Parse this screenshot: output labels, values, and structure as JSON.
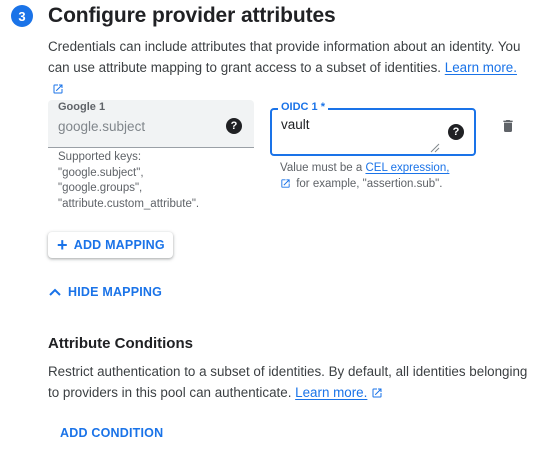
{
  "step": {
    "number": "3",
    "title": "Configure provider attributes"
  },
  "intro": {
    "text": "Credentials can include attributes that provide information about an identity. You can use attribute mapping to grant access to a subset of identities.",
    "learn_more": "Learn more."
  },
  "mapping": {
    "google_field": {
      "label": "Google 1",
      "placeholder": "google.subject",
      "help": "?"
    },
    "google_hint": [
      "Supported keys:",
      "\"google.subject\",",
      "\"google.groups\",",
      "\"attribute.custom_attribute\"."
    ],
    "oidc_field": {
      "label": "OIDC 1 *",
      "value": "vault",
      "help": "?"
    },
    "oidc_hint": {
      "prefix": "Value must be a",
      "link": "CEL expression,",
      "suffix": "for example, \"assertion.sub\"."
    }
  },
  "buttons": {
    "add_mapping": "ADD MAPPING",
    "hide_mapping": "HIDE MAPPING",
    "add_condition": "ADD CONDITION"
  },
  "conditions": {
    "title": "Attribute Conditions",
    "text": "Restrict authentication to a subset of identities. By default, all identities belonging to providers in this pool can authenticate.",
    "learn_more": "Learn more."
  },
  "icons": {
    "step_badge": "step-number-badge",
    "help": "help-icon",
    "external": "open-in-new-icon",
    "delete": "trash-icon",
    "expand": "chevron-up-icon",
    "add": "plus-icon"
  },
  "colors": {
    "accent": "#1a73e8",
    "text": "#202124",
    "muted": "#5f6368"
  }
}
